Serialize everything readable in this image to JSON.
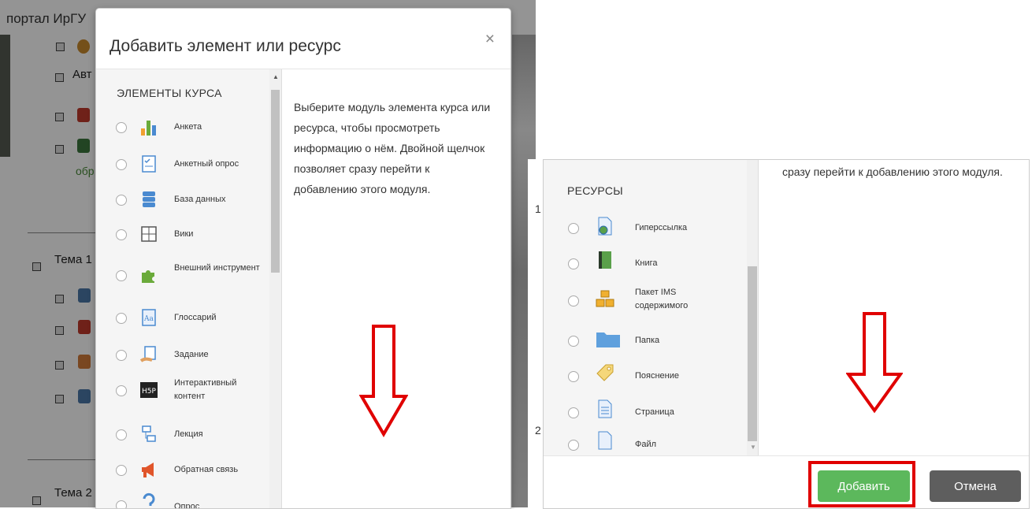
{
  "background": {
    "topbar_text": "портал ИрГУ",
    "items": [
      {
        "label": "Авт",
        "icon": "",
        "icon_color": ""
      },
      {
        "label": "",
        "icon": "pdf-icon",
        "icon_color": "#c0392b"
      },
      {
        "label": "",
        "icon": "book-icon",
        "icon_color": "#3c763d"
      },
      {
        "label": "обр",
        "icon": "",
        "icon_color": ""
      }
    ],
    "topic1": "Тема 1",
    "topic2": "Тема 2",
    "right_digits": [
      "1",
      "2"
    ]
  },
  "modal": {
    "title": "Добавить элемент или ресурс",
    "close": "×",
    "section_activities": "ЭЛЕМЕНТЫ КУРСА",
    "activities": [
      {
        "label": "Анкета",
        "icon": "survey-chart-icon"
      },
      {
        "label": "Анкетный опрос",
        "icon": "questionnaire-icon"
      },
      {
        "label": "База данных",
        "icon": "database-icon"
      },
      {
        "label": "Вики",
        "icon": "wiki-icon"
      },
      {
        "label": "Внешний инструмент",
        "icon": "puzzle-icon"
      },
      {
        "label": "Глоссарий",
        "icon": "glossary-icon"
      },
      {
        "label": "Задание",
        "icon": "assignment-icon"
      },
      {
        "label": "Интерактивный контент",
        "icon": "h5p-icon"
      },
      {
        "label": "Лекция",
        "icon": "lesson-icon"
      },
      {
        "label": "Обратная связь",
        "icon": "feedback-icon"
      },
      {
        "label": "Опрос",
        "icon": "choice-icon"
      }
    ],
    "description": "Выберите модуль элемента курса или ресурса, чтобы просмотреть информацию о нём. Двойной щелчок позволяет сразу перейти к добавлению этого модуля."
  },
  "modal_scrolled": {
    "description_tail": "сразу перейти к добавлению этого модуля.",
    "section_resources": "РЕСУРСЫ",
    "resources": [
      {
        "label": "Гиперссылка",
        "icon": "url-icon"
      },
      {
        "label": "Книга",
        "icon": "book-icon"
      },
      {
        "label": "Пакет IMS содержимого",
        "icon": "ims-package-icon"
      },
      {
        "label": "Папка",
        "icon": "folder-icon"
      },
      {
        "label": "Пояснение",
        "icon": "label-tag-icon"
      },
      {
        "label": "Страница",
        "icon": "page-icon"
      },
      {
        "label": "Файл",
        "icon": "file-icon"
      }
    ],
    "add_button": "Добавить",
    "cancel_button": "Отмена"
  },
  "colors": {
    "add_button": "#5cb85c",
    "cancel_button": "#5e5e5e",
    "annotation_red": "#e00000"
  }
}
